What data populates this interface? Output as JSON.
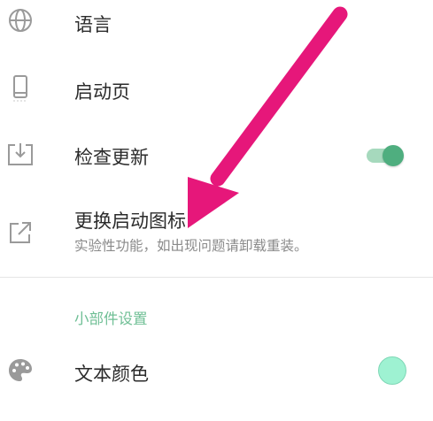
{
  "settings": {
    "language": {
      "label": "语言",
      "icon": "globe-icon"
    },
    "splash": {
      "label": "启动页",
      "icon": "phone-icon"
    },
    "update": {
      "label": "检查更新",
      "icon": "download-box-icon",
      "enabled": true
    },
    "launch_icon": {
      "label": "更换启动图标",
      "sub": "实验性功能，如出现问题请卸载重装。",
      "icon": "external-link-icon"
    }
  },
  "widget_section": {
    "title": "小部件设置",
    "text_color": {
      "label": "文本颜色",
      "icon": "palette-icon",
      "color": "#9ef2d2"
    }
  },
  "colors": {
    "accent": "#4fae7f",
    "section": "#6fbf95",
    "arrow": "#e6177a"
  }
}
